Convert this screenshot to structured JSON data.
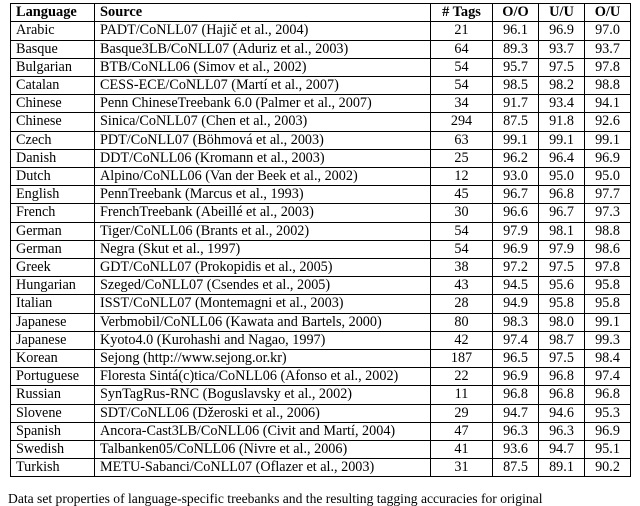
{
  "table": {
    "name": "pos-tagging-results-table",
    "columns": [
      {
        "key": "language",
        "label": "Language",
        "align": "left"
      },
      {
        "key": "source",
        "label": "Source",
        "align": "left"
      },
      {
        "key": "tags",
        "label": "# Tags",
        "align": "center"
      },
      {
        "key": "oo",
        "label": "O/O",
        "align": "center"
      },
      {
        "key": "uu",
        "label": "U/U",
        "align": "center"
      },
      {
        "key": "ou",
        "label": "O/U",
        "align": "center"
      }
    ],
    "rows": [
      {
        "language": "Arabic",
        "source": "PADT/CoNLL07 (Hajič et al., 2004)",
        "tags": "21",
        "oo": "96.1",
        "uu": "96.9",
        "ou": "97.0"
      },
      {
        "language": "Basque",
        "source": "Basque3LB/CoNLL07 (Aduriz et al., 2003)",
        "tags": "64",
        "oo": "89.3",
        "uu": "93.7",
        "ou": "93.7"
      },
      {
        "language": "Bulgarian",
        "source": "BTB/CoNLL06 (Simov et al., 2002)",
        "tags": "54",
        "oo": "95.7",
        "uu": "97.5",
        "ou": "97.8"
      },
      {
        "language": "Catalan",
        "source": "CESS-ECE/CoNLL07 (Martí et al., 2007)",
        "tags": "54",
        "oo": "98.5",
        "uu": "98.2",
        "ou": "98.8"
      },
      {
        "language": "Chinese",
        "source": "Penn ChineseTreebank 6.0 (Palmer et al., 2007)",
        "tags": "34",
        "oo": "91.7",
        "uu": "93.4",
        "ou": "94.1"
      },
      {
        "language": "Chinese",
        "source": "Sinica/CoNLL07 (Chen et al., 2003)",
        "tags": "294",
        "oo": "87.5",
        "uu": "91.8",
        "ou": "92.6"
      },
      {
        "language": "Czech",
        "source": "PDT/CoNLL07 (Böhmová et al., 2003)",
        "tags": "63",
        "oo": "99.1",
        "uu": "99.1",
        "ou": "99.1"
      },
      {
        "language": "Danish",
        "source": "DDT/CoNLL06 (Kromann et al., 2003)",
        "tags": "25",
        "oo": "96.2",
        "uu": "96.4",
        "ou": "96.9"
      },
      {
        "language": "Dutch",
        "source": "Alpino/CoNLL06 (Van der Beek et al., 2002)",
        "tags": "12",
        "oo": "93.0",
        "uu": "95.0",
        "ou": "95.0"
      },
      {
        "language": "English",
        "source": "PennTreebank (Marcus et al., 1993)",
        "tags": "45",
        "oo": "96.7",
        "uu": "96.8",
        "ou": "97.7"
      },
      {
        "language": "French",
        "source": "FrenchTreebank (Abeillé et al., 2003)",
        "tags": "30",
        "oo": "96.6",
        "uu": "96.7",
        "ou": "97.3"
      },
      {
        "language": "German",
        "source": "Tiger/CoNLL06 (Brants et al., 2002)",
        "tags": "54",
        "oo": "97.9",
        "uu": "98.1",
        "ou": "98.8"
      },
      {
        "language": "German",
        "source": "Negra (Skut et al., 1997)",
        "tags": "54",
        "oo": "96.9",
        "uu": "97.9",
        "ou": "98.6"
      },
      {
        "language": "Greek",
        "source": "GDT/CoNLL07 (Prokopidis et al., 2005)",
        "tags": "38",
        "oo": "97.2",
        "uu": "97.5",
        "ou": "97.8"
      },
      {
        "language": "Hungarian",
        "source": "Szeged/CoNLL07 (Csendes et al., 2005)",
        "tags": "43",
        "oo": "94.5",
        "uu": "95.6",
        "ou": "95.8"
      },
      {
        "language": "Italian",
        "source": "ISST/CoNLL07 (Montemagni et al., 2003)",
        "tags": "28",
        "oo": "94.9",
        "uu": "95.8",
        "ou": "95.8"
      },
      {
        "language": "Japanese",
        "source": "Verbmobil/CoNLL06 (Kawata and Bartels, 2000)",
        "tags": "80",
        "oo": "98.3",
        "uu": "98.0",
        "ou": "99.1"
      },
      {
        "language": "Japanese",
        "source": "Kyoto4.0 (Kurohashi and Nagao, 1997)",
        "tags": "42",
        "oo": "97.4",
        "uu": "98.7",
        "ou": "99.3"
      },
      {
        "language": "Korean",
        "source": "Sejong (http://www.sejong.or.kr)",
        "tags": "187",
        "oo": "96.5",
        "uu": "97.5",
        "ou": "98.4"
      },
      {
        "language": "Portuguese",
        "source": "Floresta Sintá(c)tica/CoNLL06 (Afonso et al., 2002)",
        "tags": "22",
        "oo": "96.9",
        "uu": "96.8",
        "ou": "97.4"
      },
      {
        "language": "Russian",
        "source": "SynTagRus-RNC (Boguslavsky et al., 2002)",
        "tags": "11",
        "oo": "96.8",
        "uu": "96.8",
        "ou": "96.8"
      },
      {
        "language": "Slovene",
        "source": "SDT/CoNLL06 (Džeroski et al., 2006)",
        "tags": "29",
        "oo": "94.7",
        "uu": "94.6",
        "ou": "95.3"
      },
      {
        "language": "Spanish",
        "source": "Ancora-Cast3LB/CoNLL06 (Civit and Martí, 2004)",
        "tags": "47",
        "oo": "96.3",
        "uu": "96.3",
        "ou": "96.9"
      },
      {
        "language": "Swedish",
        "source": "Talbanken05/CoNLL06 (Nivre et al., 2006)",
        "tags": "41",
        "oo": "93.6",
        "uu": "94.7",
        "ou": "95.1"
      },
      {
        "language": "Turkish",
        "source": "METU-Sabanci/CoNLL07 (Oflazer et al., 2003)",
        "tags": "31",
        "oo": "87.5",
        "uu": "89.1",
        "ou": "90.2"
      }
    ]
  },
  "caption": {
    "text": "Data set properties of language-specific treebanks and the resulting tagging accuracies for original"
  }
}
